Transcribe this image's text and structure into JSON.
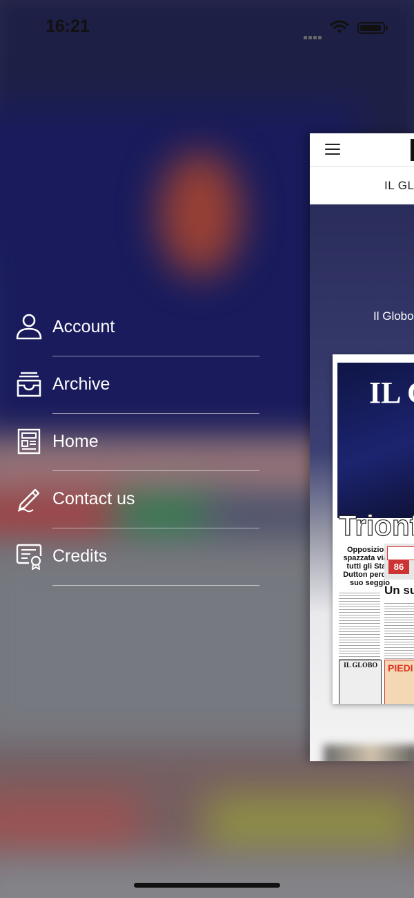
{
  "status_bar": {
    "time": "16:21"
  },
  "menu": {
    "items": [
      {
        "label": "Account",
        "icon": "person-icon"
      },
      {
        "label": "Archive",
        "icon": "archive-box-icon"
      },
      {
        "label": "Home",
        "icon": "newspaper-icon"
      },
      {
        "label": "Contact us",
        "icon": "pencil-icon"
      },
      {
        "label": "Credits",
        "icon": "certificate-icon"
      }
    ]
  },
  "panel": {
    "tab_label": "IL GLOBO",
    "hero_text": "Il Globo",
    "cover": {
      "title": "IL GLOBO",
      "headline": "Trionfo",
      "subheadline": "Opposizione spazzata via in tutti gli Stati: Dutton perde il suo seggio",
      "badge_number": "86",
      "right_headline": "Un suc",
      "footer_left": "IL GLOBO",
      "footer_right": "PIEDI"
    }
  },
  "colors": {
    "menu_text": "#ffffff",
    "accent_red": "#c33333"
  }
}
